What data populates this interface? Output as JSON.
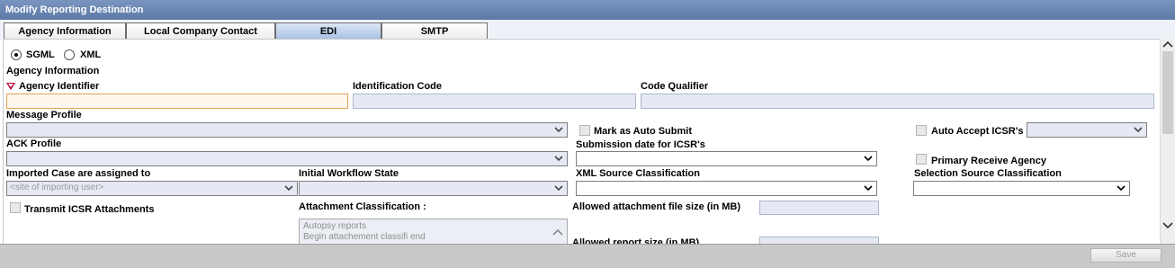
{
  "window": {
    "title": "Modify Reporting Destination"
  },
  "tabs": [
    {
      "label": "Agency Information"
    },
    {
      "label": "Local Company Contact"
    },
    {
      "label": "EDI"
    },
    {
      "label": "SMTP"
    }
  ],
  "format": {
    "sgml_label": "SGML",
    "xml_label": "XML",
    "selected": "SGML"
  },
  "section_title": "Agency Information",
  "fields": {
    "agency_identifier": {
      "label": "Agency Identifier",
      "value": "",
      "required": true
    },
    "identification_code": {
      "label": "Identification Code",
      "value": ""
    },
    "code_qualifier": {
      "label": "Code Qualifier",
      "value": ""
    },
    "message_profile": {
      "label": "Message Profile",
      "value": ""
    },
    "ack_profile": {
      "label": "ACK Profile",
      "value": ""
    },
    "mark_auto_submit": {
      "label": "Mark as Auto Submit",
      "checked": false
    },
    "auto_accept": {
      "label": "Auto Accept ICSR's",
      "checked": false,
      "value": ""
    },
    "submission_date": {
      "label": "Submission date for ICSR's",
      "value": ""
    },
    "primary_receive": {
      "label": "Primary Receive Agency",
      "checked": false
    },
    "imported_case": {
      "label": "Imported Case are assigned to",
      "value": "<site of importing user>"
    },
    "initial_workflow": {
      "label": "Initial Workflow State",
      "value": ""
    },
    "xml_source": {
      "label": "XML Source Classification",
      "value": ""
    },
    "selection_source": {
      "label": "Selection Source Classification",
      "value": ""
    },
    "transmit_attachments": {
      "label": "Transmit ICSR Attachments",
      "checked": false
    },
    "attachment_classification": {
      "label": "Attachment Classification :",
      "items": [
        "Autopsy reports",
        "Begin attachement classifi end"
      ]
    },
    "allowed_attachment_size": {
      "label": "Allowed attachment file size (in MB)",
      "value": ""
    },
    "allowed_report_size": {
      "label": "Allowed report size (in MB)",
      "value": ""
    }
  },
  "footer": {
    "save_label": "Save"
  },
  "colors": {
    "title_bar": "#6a86b3",
    "required_border": "#e3a350",
    "field_bg": "#e6e8f3"
  }
}
